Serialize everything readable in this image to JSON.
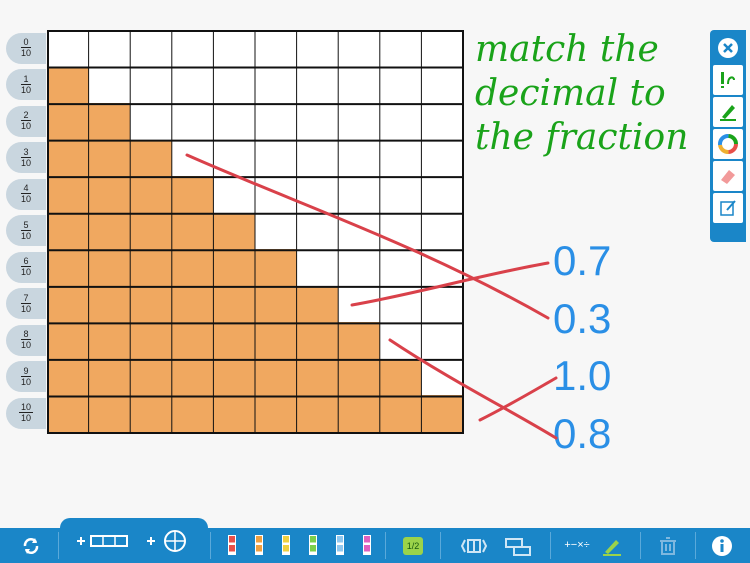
{
  "fractions": [
    {
      "num": "0",
      "den": "10"
    },
    {
      "num": "1",
      "den": "10"
    },
    {
      "num": "2",
      "den": "10"
    },
    {
      "num": "3",
      "den": "10"
    },
    {
      "num": "4",
      "den": "10"
    },
    {
      "num": "5",
      "den": "10"
    },
    {
      "num": "6",
      "den": "10"
    },
    {
      "num": "7",
      "den": "10"
    },
    {
      "num": "8",
      "den": "10"
    },
    {
      "num": "9",
      "den": "10"
    },
    {
      "num": "10",
      "den": "10"
    }
  ],
  "grid": {
    "rows": 11,
    "cols": 10,
    "filled_per_row": [
      0,
      1,
      2,
      3,
      4,
      5,
      6,
      7,
      8,
      9,
      10
    ],
    "fill_color": "#f0a860",
    "line_color": "#111111"
  },
  "decimals": [
    "0.7",
    "0.3",
    "1.0",
    "0.8"
  ],
  "handwriting": {
    "lines": [
      "match the",
      "decimal to",
      "the fraction"
    ],
    "color": "#1aa31a"
  },
  "ink": {
    "color": "#d9414a"
  },
  "colors": {
    "toolbar": "#1a86c8",
    "decimal_text": "#2a8fe6",
    "background": "#f7f7f7"
  },
  "side_tools": [
    "close-icon",
    "pen-tool-icon",
    "highlighter-icon",
    "color-wheel-icon",
    "eraser-icon",
    "edit-note-icon"
  ],
  "bottom_tools": [
    "refresh-icon",
    "add-bar-icon",
    "add-circle-icon",
    "bar-red-icon",
    "bar-orange-icon",
    "bar-yellow-icon",
    "bar-green-icon",
    "bar-blue-icon",
    "bar-magenta-icon",
    "fraction-label-icon",
    "split-icon",
    "compare-icon",
    "operations-icon",
    "pen-icon",
    "trash-icon",
    "info-icon"
  ],
  "bottom_labels": {
    "fraction_badge": "1/2",
    "ops": "+−×÷"
  }
}
